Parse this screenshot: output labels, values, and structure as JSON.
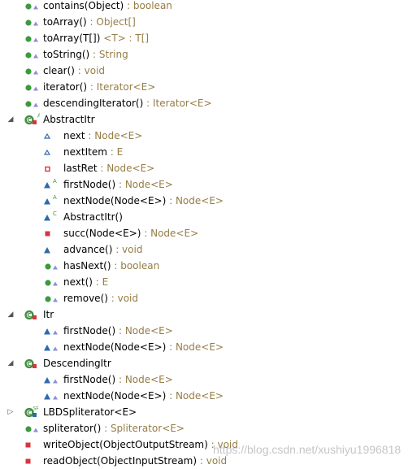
{
  "colors": {
    "public_green": "#3c9a3c",
    "default_blue": "#2f6aa8",
    "private_red": "#d8343f",
    "class_green": "#3e8f3e",
    "type_text": "#957d47",
    "watermark": "#969696"
  },
  "rows": [
    {
      "name": "contains(Object)",
      "type": "boolean"
    },
    {
      "name": "toArray()",
      "type": "Object[]"
    },
    {
      "name": "toArray(T[])",
      "tparam": "<T>",
      "type": "T[]"
    },
    {
      "name": "toString()",
      "type": "String"
    },
    {
      "name": "clear()",
      "type": "void"
    },
    {
      "name": "iterator()",
      "type": "Iterator<E>"
    },
    {
      "name": "descendingIterator()",
      "type": "Iterator<E>"
    },
    {
      "name": "AbstractItr",
      "icon": "abstract-class-icon",
      "twisty": "expanded"
    },
    {
      "name": "next",
      "type": "Node<E>",
      "icon": "default-field-icon"
    },
    {
      "name": "nextItem",
      "type": "E",
      "icon": "default-field-icon"
    },
    {
      "name": "lastRet",
      "type": "Node<E>",
      "icon": "private-field-icon"
    },
    {
      "name": "firstNode()",
      "type": "Node<E>",
      "icon": "abstract-method-icon",
      "badge": "A"
    },
    {
      "name": "nextNode(Node<E>)",
      "type": "Node<E>",
      "icon": "abstract-method-icon",
      "badge": "A"
    },
    {
      "name": "AbstractItr()",
      "icon": "constructor-icon",
      "badge": "C"
    },
    {
      "name": "succ(Node<E>)",
      "type": "Node<E>",
      "icon": "private-method-icon"
    },
    {
      "name": "advance()",
      "type": "void",
      "icon": "default-method-icon"
    },
    {
      "name": "hasNext()",
      "type": "boolean",
      "icon": "public-method-icon"
    },
    {
      "name": "next()",
      "type": "E",
      "icon": "public-method-icon"
    },
    {
      "name": "remove()",
      "type": "void",
      "icon": "public-method-icon"
    },
    {
      "name": "Itr",
      "icon": "class-icon",
      "twisty": "expanded"
    },
    {
      "name": "firstNode()",
      "type": "Node<E>",
      "icon": "default-method-override-icon"
    },
    {
      "name": "nextNode(Node<E>)",
      "type": "Node<E>",
      "icon": "default-method-override-icon"
    },
    {
      "name": "DescendingItr",
      "icon": "class-icon",
      "twisty": "expanded"
    },
    {
      "name": "firstNode()",
      "type": "Node<E>",
      "icon": "default-method-override-icon"
    },
    {
      "name": "nextNode(Node<E>)",
      "type": "Node<E>",
      "icon": "default-method-override-icon"
    },
    {
      "name": "LBDSpliterator<E>",
      "icon": "static-final-class-icon",
      "badge": "SF",
      "twisty": "collapsed"
    },
    {
      "name": "spliterator()",
      "type": "Spliterator<E>",
      "icon": "public-method-icon"
    },
    {
      "name": "writeObject(ObjectOutputStream)",
      "type": "void",
      "icon": "private-method-icon"
    },
    {
      "name": "readObject(ObjectInputStream)",
      "type": "void",
      "icon": "private-method-icon"
    }
  ],
  "watermark": "https://blog.csdn.net/xushiyu1996818",
  "type_separator": " : "
}
